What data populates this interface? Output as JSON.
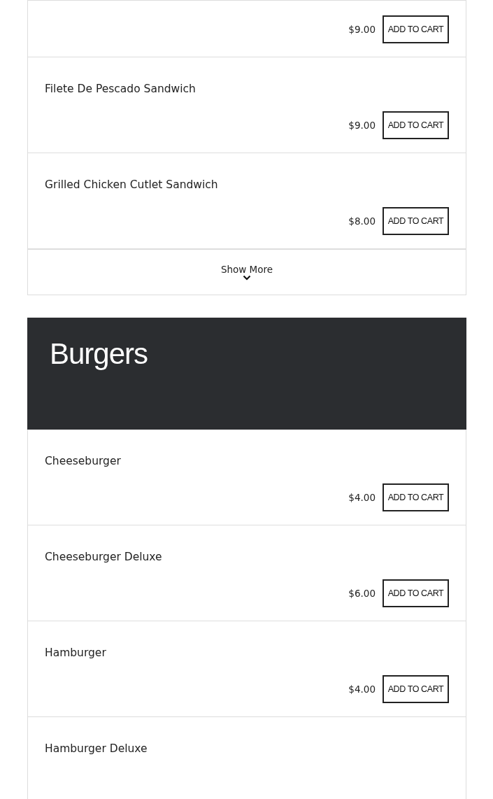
{
  "sections": [
    {
      "items": [
        {
          "price": "$9.00",
          "button": "ADD TO CART"
        },
        {
          "name": "Filete De Pescado Sandwich",
          "price": "$9.00",
          "button": "ADD TO CART"
        },
        {
          "name": "Grilled Chicken Cutlet Sandwich",
          "price": "$8.00",
          "button": "ADD TO CART"
        }
      ],
      "show_more": "Show More"
    },
    {
      "title": "Burgers",
      "items": [
        {
          "name": "Cheeseburger",
          "price": "$4.00",
          "button": "ADD TO CART"
        },
        {
          "name": "Cheeseburger Deluxe",
          "price": "$6.00",
          "button": "ADD TO CART"
        },
        {
          "name": "Hamburger",
          "price": "$4.00",
          "button": "ADD TO CART"
        },
        {
          "name": "Hamburger Deluxe"
        }
      ]
    }
  ]
}
